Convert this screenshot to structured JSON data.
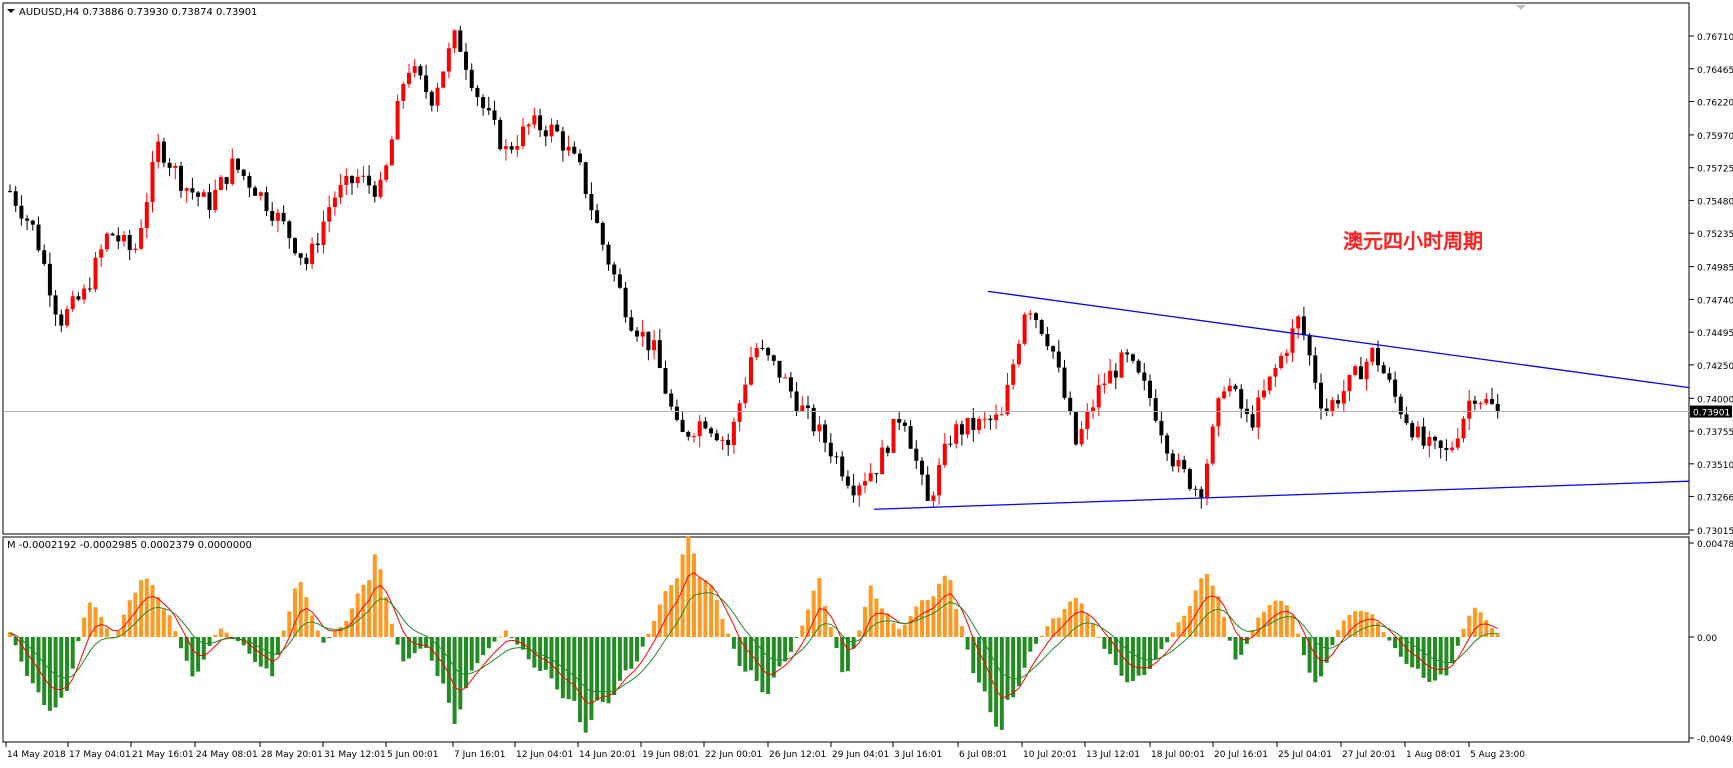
{
  "main_panel": {
    "header_text": "AUDUSD,H4  0.73886 0.73930 0.73874 0.73901",
    "annotation": "澳元四小时周期",
    "current_price_label": "0.73901",
    "price_ticks": [
      "0.76710",
      "0.76465",
      "0.76220",
      "0.75970",
      "0.75725",
      "0.75480",
      "0.75235",
      "0.74985",
      "0.74740",
      "0.74495",
      "0.74250",
      "0.74000",
      "0.73755",
      "0.73510",
      "0.73266",
      "0.73015"
    ]
  },
  "sub_panel": {
    "header_text": "M -0.0002192 -0.0002985 0.0002379 0.0000000",
    "ticks": [
      "0.004789",
      "0.00",
      "-0.004936"
    ]
  },
  "time_axis": {
    "labels": [
      "14 May 2018",
      "17 May 04:01",
      "21 May 16:01",
      "24 May 08:01",
      "28 May 20:01",
      "31 May 12:01",
      "5 Jun 00:01",
      "7 Jun 16:01",
      "12 Jun 04:01",
      "14 Jun 20:01",
      "19 Jun 08:01",
      "22 Jun 00:01",
      "26 Jun 12:01",
      "29 Jun 04:01",
      "3 Jul 16:01",
      "6 Jul 08:01",
      "10 Jul 20:01",
      "13 Jul 12:01",
      "18 Jul 00:01",
      "20 Jul 16:01",
      "25 Jul 04:01",
      "27 Jul 20:01",
      "1 Aug 08:01",
      "5 Aug 23:00"
    ]
  },
  "colors": {
    "bull": "#ff0000",
    "bear": "#000000",
    "trendline": "#0000ff",
    "macd_pos": "#ff9922",
    "macd_neg": "#228b22",
    "signal_red": "#ff0000",
    "signal_green": "#228b22"
  },
  "chart_data": {
    "type": "candlestick",
    "symbol": "AUDUSD",
    "timeframe": "H4",
    "last_bar": {
      "open": 0.73886,
      "high": 0.7393,
      "low": 0.73874,
      "close": 0.73901
    },
    "ylim": [
      0.73015,
      0.7671
    ],
    "close_path": [
      {
        "x": "14 May 2018",
        "y": 0.7555
      },
      {
        "x": "15 May",
        "y": 0.7525
      },
      {
        "x": "16 May",
        "y": 0.7458
      },
      {
        "x": "17 May 04:01",
        "y": 0.7478
      },
      {
        "x": "18 May",
        "y": 0.7525
      },
      {
        "x": "19 May",
        "y": 0.7508
      },
      {
        "x": "21 May 16:01",
        "y": 0.759
      },
      {
        "x": "22 May",
        "y": 0.756
      },
      {
        "x": "23 May",
        "y": 0.7545
      },
      {
        "x": "24 May 08:01",
        "y": 0.7575
      },
      {
        "x": "25 May",
        "y": 0.7555
      },
      {
        "x": "27 May",
        "y": 0.753
      },
      {
        "x": "28 May 20:01",
        "y": 0.75
      },
      {
        "x": "30 May",
        "y": 0.755
      },
      {
        "x": "31 May 12:01",
        "y": 0.7565
      },
      {
        "x": "1 Jun",
        "y": 0.7555
      },
      {
        "x": "4 Jun",
        "y": 0.765
      },
      {
        "x": "5 Jun 00:01",
        "y": 0.7625
      },
      {
        "x": "6 Jun",
        "y": 0.7672
      },
      {
        "x": "7 Jun 16:01",
        "y": 0.762
      },
      {
        "x": "8 Jun",
        "y": 0.7585
      },
      {
        "x": "11 Jun",
        "y": 0.7605
      },
      {
        "x": "12 Jun 04:01",
        "y": 0.76
      },
      {
        "x": "13 Jun",
        "y": 0.757
      },
      {
        "x": "14 Jun",
        "y": 0.751
      },
      {
        "x": "14 Jun 20:01",
        "y": 0.746
      },
      {
        "x": "15 Jun",
        "y": 0.7435
      },
      {
        "x": "18 Jun",
        "y": 0.737
      },
      {
        "x": "19 Jun 08:01",
        "y": 0.7385
      },
      {
        "x": "20 Jun",
        "y": 0.7365
      },
      {
        "x": "21 Jun",
        "y": 0.744
      },
      {
        "x": "22 Jun 00:01",
        "y": 0.742
      },
      {
        "x": "25 Jun",
        "y": 0.739
      },
      {
        "x": "26 Jun 12:01",
        "y": 0.7365
      },
      {
        "x": "27 Jun",
        "y": 0.7335
      },
      {
        "x": "28 Jun",
        "y": 0.735
      },
      {
        "x": "29 Jun",
        "y": 0.7392
      },
      {
        "x": "29 Jun 04:01",
        "y": 0.732
      },
      {
        "x": "2 Jul",
        "y": 0.7375
      },
      {
        "x": "3 Jul 16:01",
        "y": 0.738
      },
      {
        "x": "5 Jul",
        "y": 0.7385
      },
      {
        "x": "6 Jul 08:01",
        "y": 0.7474
      },
      {
        "x": "9 Jul",
        "y": 0.744
      },
      {
        "x": "10 Jul 20:01",
        "y": 0.7365
      },
      {
        "x": "12 Jul",
        "y": 0.741
      },
      {
        "x": "13 Jul 12:01",
        "y": 0.743
      },
      {
        "x": "16 Jul",
        "y": 0.74
      },
      {
        "x": "18 Jul 00:01",
        "y": 0.735
      },
      {
        "x": "19 Jul",
        "y": 0.733
      },
      {
        "x": "20 Jul 16:01",
        "y": 0.7415
      },
      {
        "x": "23 Jul",
        "y": 0.738
      },
      {
        "x": "24 Jul",
        "y": 0.742
      },
      {
        "x": "25 Jul 04:01",
        "y": 0.746
      },
      {
        "x": "26 Jul",
        "y": 0.739
      },
      {
        "x": "27 Jul 20:01",
        "y": 0.741
      },
      {
        "x": "30 Jul",
        "y": 0.7435
      },
      {
        "x": "31 Jul",
        "y": 0.7395
      },
      {
        "x": "1 Aug 08:01",
        "y": 0.7365
      },
      {
        "x": "2 Aug",
        "y": 0.7358
      },
      {
        "x": "3 Aug",
        "y": 0.7405
      },
      {
        "x": "5 Aug 23:00",
        "y": 0.73901
      }
    ],
    "trendlines": [
      {
        "from": {
          "x": "6 Jul 08:01",
          "y": 0.748
        },
        "to": {
          "x": "right-edge",
          "y": 0.7408
        }
      },
      {
        "from": {
          "x": "29 Jun 04:01",
          "y": 0.7317
        },
        "to": {
          "x": "right-edge",
          "y": 0.7338
        }
      }
    ],
    "horizontal_line": 0.73901,
    "macd_hist_path": [
      {
        "x": "14 May 2018",
        "y": 0.0003
      },
      {
        "x": "15 May",
        "y": -0.003
      },
      {
        "x": "16 May",
        "y": -0.0038
      },
      {
        "x": "17 May",
        "y": 0.002
      },
      {
        "x": "18 May",
        "y": -0.0002
      },
      {
        "x": "21 May",
        "y": 0.0031
      },
      {
        "x": "22 May",
        "y": 0.0015
      },
      {
        "x": "23 May",
        "y": -0.0022
      },
      {
        "x": "24 May",
        "y": 0.0005
      },
      {
        "x": "25 May",
        "y": -0.0005
      },
      {
        "x": "28 May",
        "y": -0.0022
      },
      {
        "x": "29 May",
        "y": 0.003
      },
      {
        "x": "30 May",
        "y": -0.0003
      },
      {
        "x": "31 May",
        "y": 0.001
      },
      {
        "x": "1 Jun",
        "y": 0.0041
      },
      {
        "x": "4 Jun",
        "y": -0.0012
      },
      {
        "x": "5 Jun",
        "y": -0.0005
      },
      {
        "x": "7 Jun",
        "y": -0.0042
      },
      {
        "x": "8 Jun",
        "y": -0.001
      },
      {
        "x": "11 Jun",
        "y": 0.0003
      },
      {
        "x": "12 Jun",
        "y": -0.0013
      },
      {
        "x": "13 Jun",
        "y": -0.0025
      },
      {
        "x": "14 Jun",
        "y": -0.0045
      },
      {
        "x": "15 Jun",
        "y": -0.003
      },
      {
        "x": "18 Jun",
        "y": -0.0012
      },
      {
        "x": "19 Jun",
        "y": 0.0018
      },
      {
        "x": "21 Jun",
        "y": 0.0046
      },
      {
        "x": "22 Jun",
        "y": 0.002
      },
      {
        "x": "25 Jun",
        "y": -0.0015
      },
      {
        "x": "26 Jun",
        "y": -0.0028
      },
      {
        "x": "27 Jun",
        "y": -0.0005
      },
      {
        "x": "28 Jun",
        "y": 0.0028
      },
      {
        "x": "29 Jun",
        "y": -0.0022
      },
      {
        "x": "2 Jul",
        "y": 0.0025
      },
      {
        "x": "3 Jul",
        "y": 0.0003
      },
      {
        "x": "5 Jul",
        "y": 0.0018
      },
      {
        "x": "6 Jul",
        "y": 0.003
      },
      {
        "x": "9 Jul",
        "y": -0.0022
      },
      {
        "x": "10 Jul",
        "y": -0.0047
      },
      {
        "x": "11 Jul",
        "y": -0.001
      },
      {
        "x": "12 Jul",
        "y": 0.001
      },
      {
        "x": "13 Jul",
        "y": 0.002
      },
      {
        "x": "16 Jul",
        "y": -0.0008
      },
      {
        "x": "17 Jul",
        "y": -0.0025
      },
      {
        "x": "18 Jul",
        "y": -0.001
      },
      {
        "x": "19 Jul",
        "y": 0.0012
      },
      {
        "x": "20 Jul",
        "y": 0.0035
      },
      {
        "x": "23 Jul",
        "y": -0.0015
      },
      {
        "x": "24 Jul",
        "y": 0.0015
      },
      {
        "x": "25 Jul",
        "y": 0.0018
      },
      {
        "x": "26 Jul",
        "y": -0.0028
      },
      {
        "x": "27 Jul",
        "y": 0.0008
      },
      {
        "x": "30 Jul",
        "y": 0.0015
      },
      {
        "x": "31 Jul",
        "y": -0.0005
      },
      {
        "x": "1 Aug",
        "y": -0.002
      },
      {
        "x": "2 Aug",
        "y": -0.0022
      },
      {
        "x": "3 Aug",
        "y": 0.0016
      },
      {
        "x": "5 Aug 23:00",
        "y": 0.0002
      }
    ],
    "macd_hist_ylim": [
      -0.004936,
      0.004789
    ]
  }
}
